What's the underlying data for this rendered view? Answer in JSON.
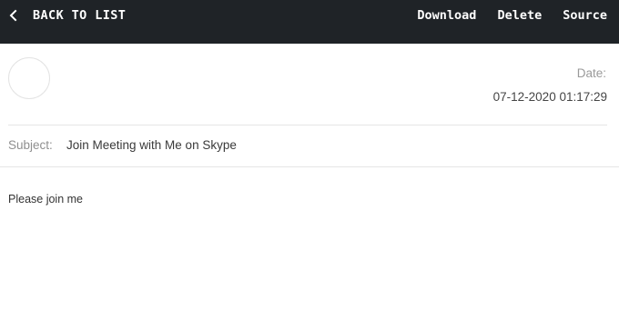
{
  "topbar": {
    "back_label": "BACK TO LIST",
    "back_icon": "chevron-left-icon",
    "actions": [
      {
        "id": "download",
        "label": "Download"
      },
      {
        "id": "delete",
        "label": "Delete"
      },
      {
        "id": "source",
        "label": "Source"
      }
    ],
    "bg_color": "#1f2327"
  },
  "message": {
    "date_label": "Date:",
    "date_value": "07-12-2020 01:17:29",
    "subject_label": "Subject:",
    "subject_value": "Join Meeting with Me on Skype",
    "body": "Please join me"
  }
}
